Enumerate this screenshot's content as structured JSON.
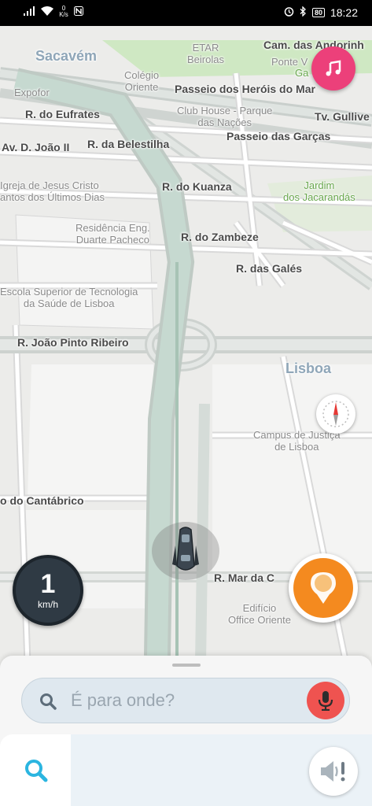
{
  "status_bar": {
    "network_speed_value": "0",
    "network_speed_unit": "K/s",
    "battery": "80",
    "time": "18:22"
  },
  "map": {
    "labels": {
      "sacavem": "Sacavém",
      "etar": "ETAR\nBeirolas",
      "cam_das_andorinhas": "Cam. das Andorinh",
      "ponte_vasco": "Ponte V",
      "ga": "Ga",
      "colegio_oriente": "Colégio\nOriente",
      "expofor": "Expofor",
      "passeio_herois_mar": "Passeio dos Heróis do Mar",
      "r_eufrates": "R. do Eufrates",
      "club_house": "Club House - Parque\ndas Nações",
      "tv_gulliver": "Tv. Gullive",
      "av_d_joao_ii": "Av. D. João II",
      "r_belestilha": "R. da Belestilha",
      "passeio_garcas": "Passeio das Garças",
      "igreja": "Igreja de Jesus Cristo\nantos dos Últimos Dias",
      "r_kuanza": "R. do Kuanza",
      "jardim_jacarandas": "Jardim\ndos Jacarandás",
      "residencia": "Residência Eng.\nDuarte Pacheco",
      "r_zambeze": "R. do Zambeze",
      "r_gales": "R. das Galés",
      "escola_superior": "Escola Superior de Tecnologia\nda Saúde de Lisboa",
      "r_joao_pinto_ribeiro": "R. João Pinto Ribeiro",
      "lisboa": "Lisboa",
      "campus_justica": "Campus de Justiça\nde Lisboa",
      "cantabrico": "o do Cantábrico",
      "r_mar_da_china": "R. Mar da C",
      "edificio_office": "Edifício\nOffice Oriente"
    }
  },
  "speedometer": {
    "value": "1",
    "unit": "km/h"
  },
  "search": {
    "placeholder": "É para onde?"
  },
  "colors": {
    "music_button": "#ec407a",
    "report_button": "#f48a1f",
    "mic_button": "#ef5350",
    "accent": "#2bb5e0",
    "route": "#c6d9d0"
  },
  "icons": {
    "music": "music-note-icon",
    "compass": "compass-icon",
    "report": "report-pin-icon",
    "mic": "microphone-icon",
    "search": "search-icon",
    "sound": "speaker-alert-icon"
  }
}
